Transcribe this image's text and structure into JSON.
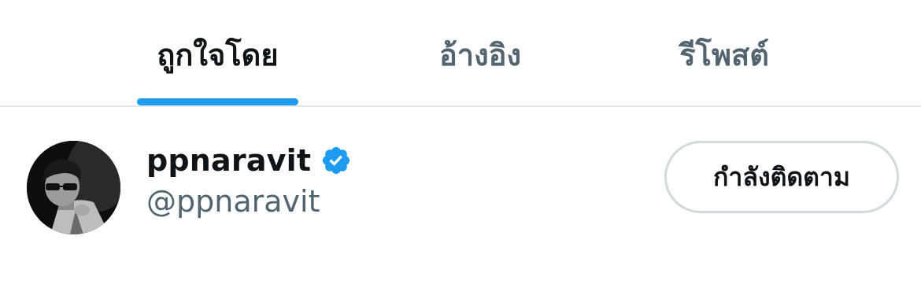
{
  "tabs": [
    {
      "label": "ถูกใจโดย",
      "active": true
    },
    {
      "label": "อ้างอิง",
      "active": false
    },
    {
      "label": "รีโพสต์",
      "active": false
    }
  ],
  "user": {
    "display_name": "ppnaravit",
    "handle": "@ppnaravit",
    "verified": true,
    "avatar_icon": "profile-photo"
  },
  "follow_button": {
    "label": "กำลังติดตาม"
  },
  "colors": {
    "accent": "#1d9bf0",
    "text_primary": "#0f1419",
    "text_secondary": "#536471",
    "border": "#cfd9de"
  }
}
